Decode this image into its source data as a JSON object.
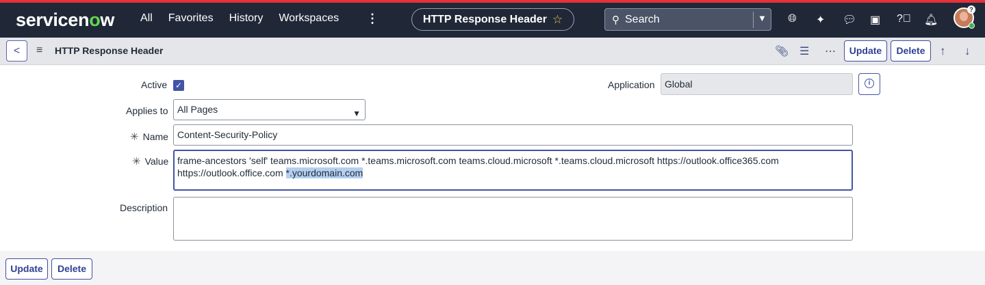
{
  "topnav": {
    "logo": {
      "pre": "servicen",
      "o": "o",
      "post": "w"
    },
    "links": [
      "All",
      "Favorites",
      "History",
      "Workspaces"
    ],
    "more_icon": "more-vertical-icon",
    "current_page": "HTTP Response Header",
    "search_label": "Search",
    "icons": [
      "globe-icon",
      "sparkle-icon",
      "chat-icon",
      "screen-icon",
      "help-icon",
      "bell-icon"
    ]
  },
  "header": {
    "title": "HTTP Response Header",
    "update_label": "Update",
    "delete_label": "Delete"
  },
  "form": {
    "active": {
      "label": "Active",
      "checked": true
    },
    "application": {
      "label": "Application",
      "value": "Global"
    },
    "applies_to": {
      "label": "Applies to",
      "value": "All Pages"
    },
    "name": {
      "label": "Name",
      "value": "Content-Security-Policy"
    },
    "value": {
      "label": "Value",
      "line1": "frame-ancestors 'self' teams.microsoft.com *.teams.microsoft.com teams.cloud.microsoft *.teams.cloud.microsoft https://outlook.office365.com",
      "line2_plain": "https://outlook.office.com ",
      "line2_selected": "*.yourdomain.com"
    },
    "description": {
      "label": "Description",
      "value": ""
    }
  },
  "footer": {
    "update_label": "Update",
    "delete_label": "Delete"
  }
}
